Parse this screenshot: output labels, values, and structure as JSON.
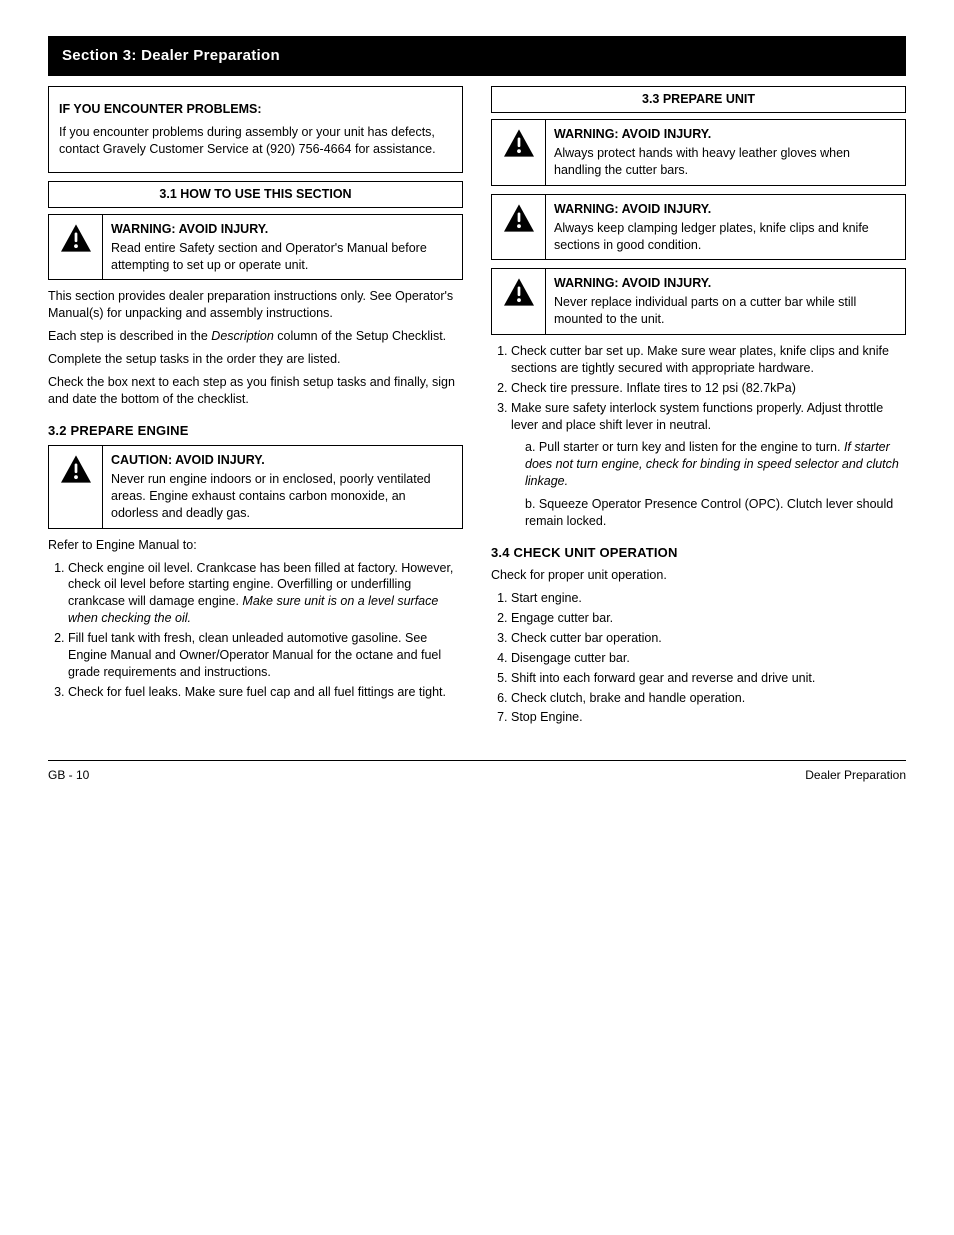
{
  "header": "Section 3: Dealer Preparation",
  "left": {
    "intro_heading": "IF YOU ENCOUNTER PROBLEMS:",
    "intro_body": "If you encounter problems during assembly or your unit has defects, contact Gravely Customer Service at (920) 756-4664 for assistance.",
    "h1": "3.1 HOW TO USE THIS SECTION",
    "wbox_title": "WARNING: AVOID INJURY.",
    "wbox_body": "Read entire Safety section and Operator's Manual before attempting to set up or operate unit.",
    "p1": "This section provides dealer preparation instructions only. See Operator's Manual(s) for unpacking and assembly instructions.",
    "p2_1": "Each step is described in the ",
    "p2_em": "Description",
    "p2_2": " column of the Setup Checklist.",
    "p3": "Complete the setup tasks in the order they are listed.",
    "p4": "Check the box next to each step as you finish setup tasks and finally, sign and date the bottom of the checklist.",
    "h2": "3.2 PREPARE ENGINE",
    "w2_title": "CAUTION: AVOID INJURY.",
    "w2_body": "Never run engine indoors or in enclosed, poorly ventilated areas. Engine exhaust contains carbon monoxide, an odorless and deadly gas.",
    "refer": "Refer to Engine Manual to:",
    "li1_1": "Check engine oil level. Crankcase has been filled at factory. However, check oil level before starting engine. Overfilling or underfilling crankcase will damage engine. ",
    "li1_em": "Make sure unit is on a level surface when checking the oil.",
    "li2": "Fill fuel tank with fresh, clean unleaded automotive gasoline. See Engine Manual and Owner/Operator Manual for the octane and fuel grade requirements and instructions.",
    "li3": "Check for fuel leaks. Make sure fuel cap and all fuel fittings are tight."
  },
  "right": {
    "heading": "3.3 PREPARE UNIT",
    "w1_title": "WARNING: AVOID INJURY.",
    "w1_body": "Always protect hands with heavy leather gloves when handling the cutter bars.",
    "w2_title": "WARNING: AVOID INJURY.",
    "w2_body": "Always keep clamping ledger plates, knife clips and knife sections in good condition.",
    "w3_title": "WARNING: AVOID INJURY.",
    "w3_body": "Never replace individual parts on a cutter bar while still mounted to the unit.",
    "steps_intro": "",
    "li1": "Check cutter bar set up. Make sure wear plates, knife clips and knife sections are tightly secured with appropriate hardware.",
    "li2": "Check tire pressure. Inflate tires to 12 psi (82.7kPa)",
    "li3": "Make sure safety interlock system functions properly. Adjust throttle lever and place shift lever in neutral.",
    "li3a_1": "Pull starter or turn key and listen for the engine to turn. ",
    "li3a_em": "If starter does not turn engine, check for binding in speed selector and clutch linkage.",
    "li3b": "Squeeze Operator Presence Control (OPC). Clutch lever should remain locked.",
    "h4": "3.4 CHECK UNIT OPERATION",
    "op_intro": "Check for proper unit operation.",
    "op1": "Start engine.",
    "op2": "Engage cutter bar.",
    "op3": "Check cutter bar operation.",
    "op4": "Disengage cutter bar.",
    "op5": "Shift into each forward gear and reverse and drive unit.",
    "op6": "Check clutch, brake and handle operation.",
    "op7": "Stop Engine."
  },
  "footer": {
    "left": "GB - 10",
    "right": "Dealer Preparation"
  }
}
